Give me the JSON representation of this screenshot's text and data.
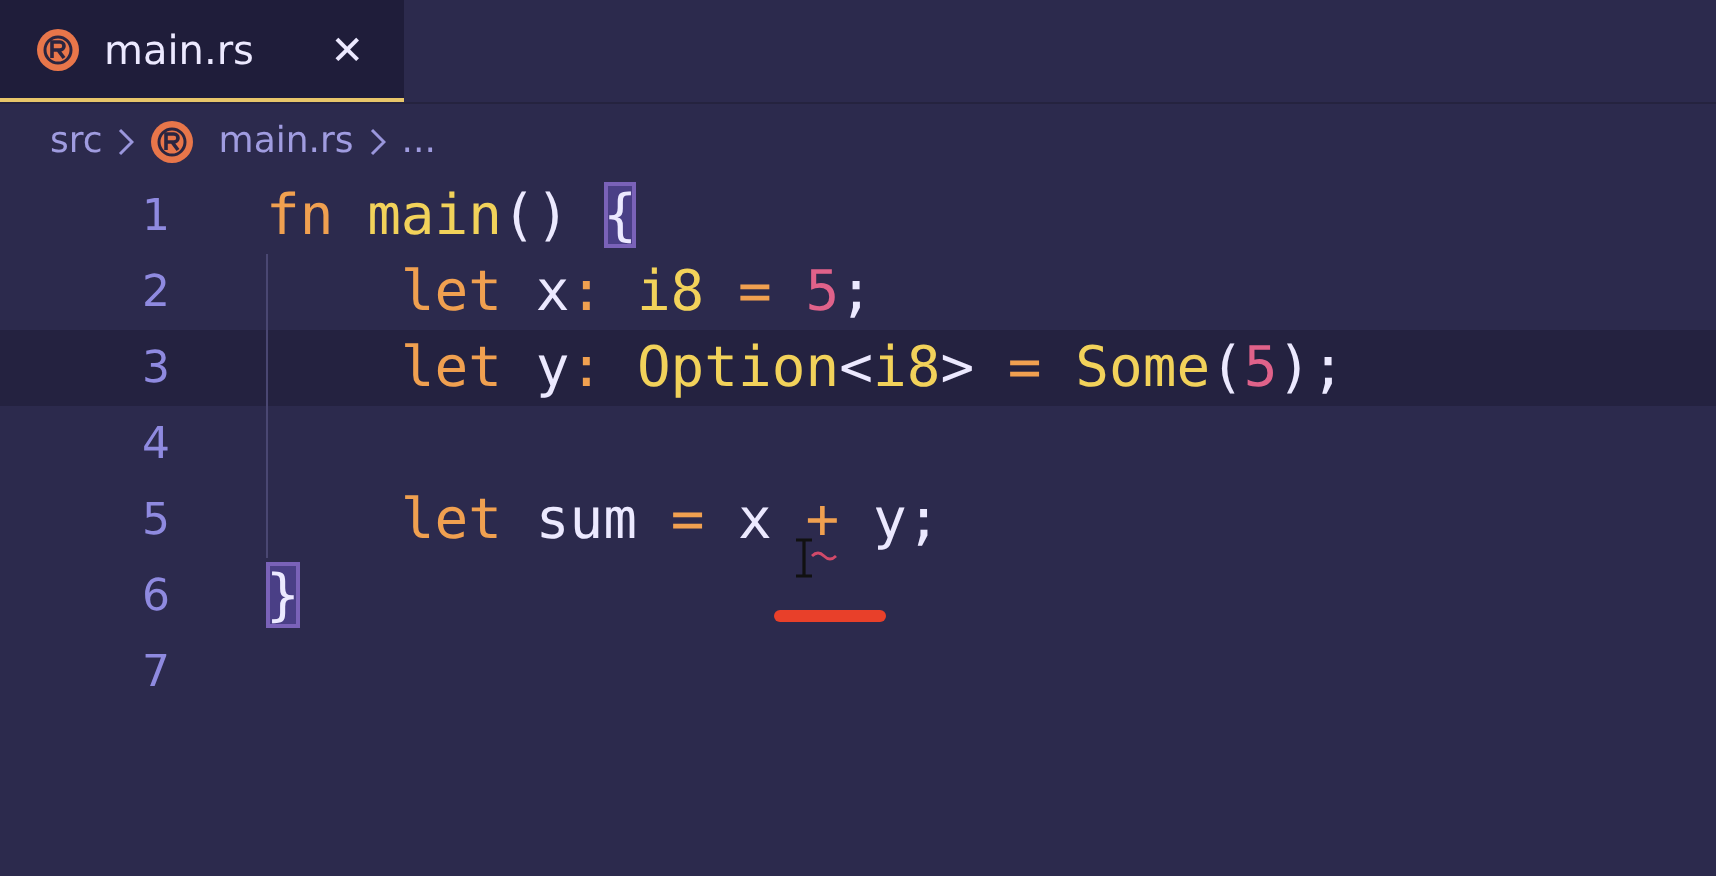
{
  "tabs": [
    {
      "label": "main.rs",
      "selected": true,
      "close": "✕"
    }
  ],
  "breadcrumb": [
    {
      "label": "src",
      "kind": "folder"
    },
    {
      "label": "main.rs",
      "kind": "file"
    },
    {
      "label": "...",
      "kind": "more"
    }
  ],
  "lines": [
    {
      "number": "1",
      "current": false,
      "tokens": [
        {
          "text": "fn",
          "kind": "keyword"
        },
        {
          "text": " main",
          "kind": "function"
        },
        {
          "text": "() ",
          "kind": "plain"
        },
        {
          "text": "{",
          "kind": "bracket-match"
        }
      ]
    },
    {
      "number": "2",
      "current": false,
      "tokens": [
        {
          "text": "    let",
          "kind": "keyword"
        },
        {
          "text": " x",
          "kind": "plain"
        },
        {
          "text": ":",
          "kind": "operator"
        },
        {
          "text": " i8",
          "kind": "type"
        },
        {
          "text": " =",
          "kind": "operator"
        },
        {
          "text": " 5",
          "kind": "number"
        },
        {
          "text": ";",
          "kind": "plain"
        }
      ]
    },
    {
      "number": "3",
      "current": true,
      "tokens": [
        {
          "text": "    let",
          "kind": "keyword"
        },
        {
          "text": " y",
          "kind": "plain"
        },
        {
          "text": ":",
          "kind": "operator"
        },
        {
          "text": " Option",
          "kind": "type"
        },
        {
          "text": "<",
          "kind": "plain"
        },
        {
          "text": "i8",
          "kind": "type"
        },
        {
          "text": "> ",
          "kind": "plain"
        },
        {
          "text": "=",
          "kind": "operator"
        },
        {
          "text": " Some",
          "kind": "type"
        },
        {
          "text": "(",
          "kind": "plain"
        },
        {
          "text": "5",
          "kind": "number"
        },
        {
          "text": ");",
          "kind": "plain"
        }
      ]
    },
    {
      "number": "4",
      "current": false
    },
    {
      "number": "5",
      "current": false,
      "tokens": [
        {
          "text": "    let",
          "kind": "keyword"
        },
        {
          "text": " sum ",
          "kind": "plain"
        },
        {
          "text": "=",
          "kind": "operator"
        },
        {
          "text": " x ",
          "kind": "plain"
        },
        {
          "text": "+",
          "kind": "error-operator"
        },
        {
          "text": " y;",
          "kind": "plain"
        }
      ]
    },
    {
      "number": "6",
      "current": false,
      "tokens": [
        {
          "text": "}",
          "kind": "bracket-match"
        }
      ]
    },
    {
      "number": "7",
      "current": false
    }
  ]
}
